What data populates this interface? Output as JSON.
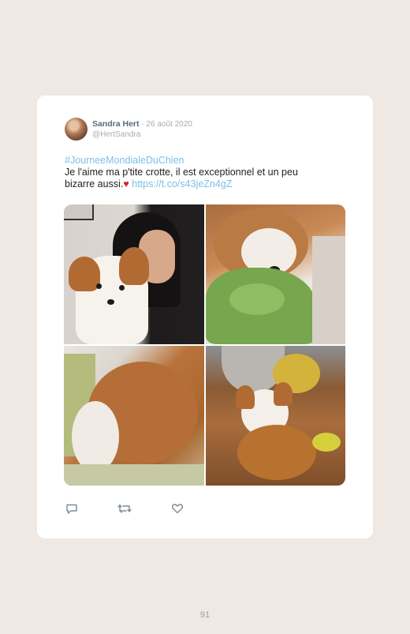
{
  "tweet": {
    "author_name": "Sandra Hert",
    "separator": " · ",
    "date": "26 août 2020",
    "handle": "@HertSandra",
    "hashtag": "#JourneeMondialeDuChien",
    "text_line1": "Je l'aime ma p'tite crotte, il est exceptionnel et un peu",
    "text_line2": "bizarre aussi.",
    "heart_emoji": "♥",
    "link": "https://t.co/s43jeZn4gZ"
  },
  "actions": {
    "icons": [
      "reply-icon",
      "retweet-icon",
      "like-icon"
    ]
  },
  "page": {
    "number": "91"
  },
  "colors": {
    "background": "#efe8e3",
    "card": "#ffffff",
    "link": "#7cc0e7",
    "heart": "#cf1d33"
  }
}
